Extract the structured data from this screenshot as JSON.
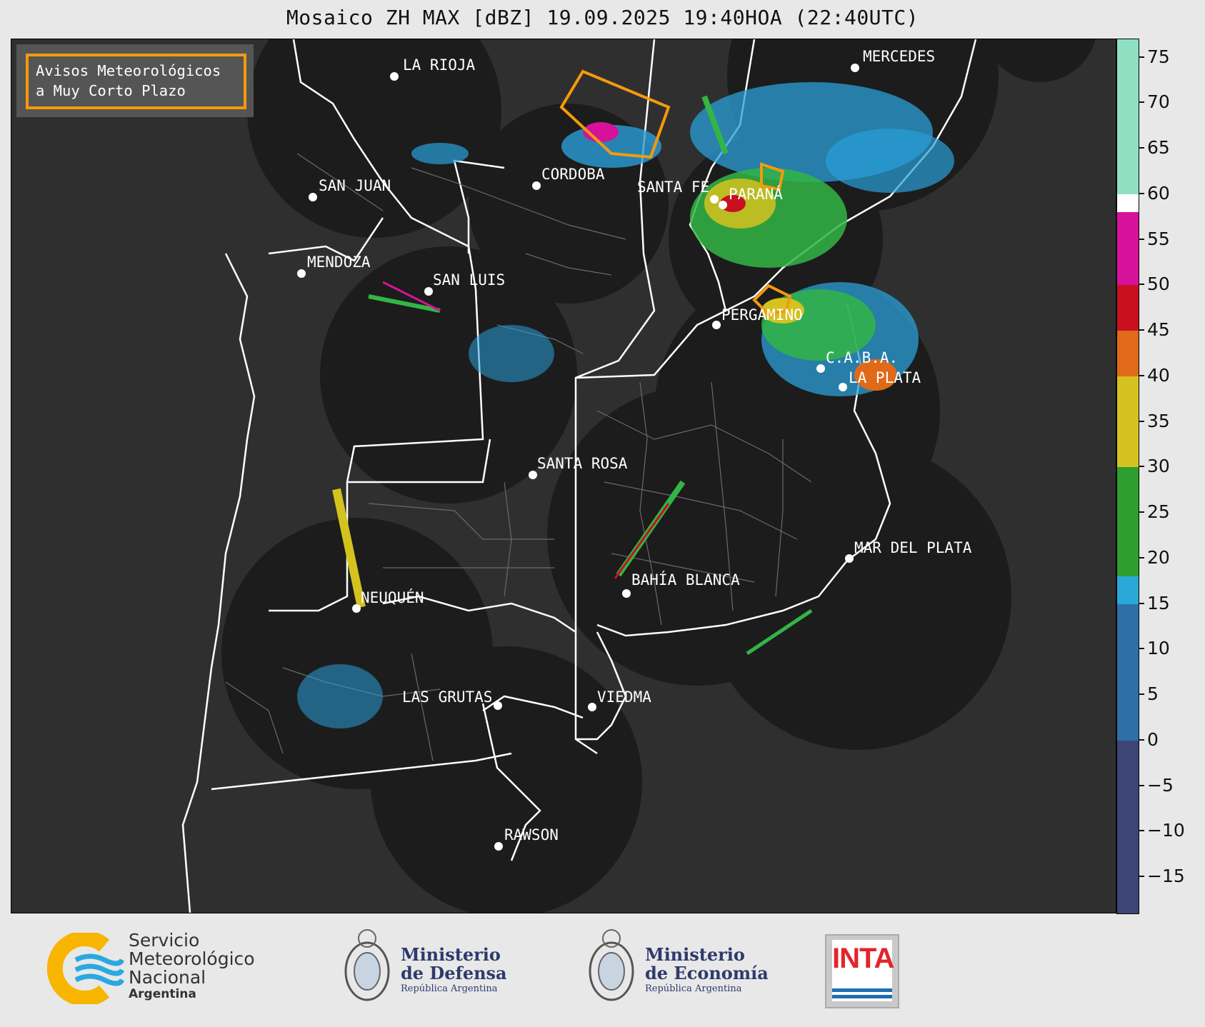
{
  "title": "Mosaico ZH MAX [dBZ] 19.09.2025 19:40HOA (22:40UTC)",
  "warning_box": {
    "line1": "Avisos Meteorológicos",
    "line2": "a Muy Corto Plazo",
    "border_color": "#f59a0b"
  },
  "cities": [
    {
      "name": "LA RIOJA",
      "label": "LA RIOJA"
    },
    {
      "name": "MERCEDES",
      "label": "MERCEDES"
    },
    {
      "name": "CORDOBA",
      "label": "CORDOBA"
    },
    {
      "name": "SAN JUAN",
      "label": "SAN JUAN"
    },
    {
      "name": "SANTA FE",
      "label": "SANTA FE"
    },
    {
      "name": "PARANA",
      "label": "PARANÁ"
    },
    {
      "name": "MENDOZA",
      "label": "MENDOZA"
    },
    {
      "name": "SAN LUIS",
      "label": "SAN LUIS"
    },
    {
      "name": "PERGAMINO",
      "label": "PERGAMINO"
    },
    {
      "name": "CABA",
      "label": "C.A.B.A."
    },
    {
      "name": "LA PLATA",
      "label": "LA PLATA"
    },
    {
      "name": "SANTA ROSA",
      "label": "SANTA ROSA"
    },
    {
      "name": "MAR DEL PLATA",
      "label": "MAR DEL PLATA"
    },
    {
      "name": "BAHIA BLANCA",
      "label": "BAHÍA BLANCA"
    },
    {
      "name": "NEUQUEN",
      "label": "NEUQUÉN"
    },
    {
      "name": "LAS GRUTAS",
      "label": "LAS GRUTAS"
    },
    {
      "name": "VIEDMA",
      "label": "VIEDMA"
    },
    {
      "name": "RAWSON",
      "label": "RAWSON"
    }
  ],
  "colorbar": {
    "unit": "dBZ",
    "ticks": [
      "75",
      "70",
      "65",
      "60",
      "55",
      "50",
      "45",
      "40",
      "35",
      "30",
      "25",
      "20",
      "15",
      "10",
      "5",
      "0",
      "−5",
      "−10",
      "−15"
    ],
    "stops": [
      {
        "from": -19,
        "to": 0,
        "color": "#3c4575"
      },
      {
        "from": 0,
        "to": 15,
        "color": "#2f6fa8"
      },
      {
        "from": 15,
        "to": 18,
        "color": "#2aa8d8"
      },
      {
        "from": 18,
        "to": 30,
        "color": "#2e9e2e"
      },
      {
        "from": 30,
        "to": 40,
        "color": "#d4c21f"
      },
      {
        "from": 40,
        "to": 45,
        "color": "#e06a1a"
      },
      {
        "from": 45,
        "to": 50,
        "color": "#c8101e"
      },
      {
        "from": 50,
        "to": 58,
        "color": "#d6129a"
      },
      {
        "from": 58,
        "to": 60,
        "color": "#ffffff"
      },
      {
        "from": 60,
        "to": 77,
        "color": "#8fe0c2"
      }
    ]
  },
  "footer": {
    "smn_line1": "Servicio",
    "smn_line2": "Meteorológico",
    "smn_line3": "Nacional",
    "smn_line4": "Argentina",
    "defensa_line1": "Ministerio",
    "defensa_line2": "de Defensa",
    "defensa_line3": "República Argentina",
    "economia_line1": "Ministerio",
    "economia_line2": "de Economía",
    "economia_line3": "República Argentina",
    "inta": "INTA"
  }
}
